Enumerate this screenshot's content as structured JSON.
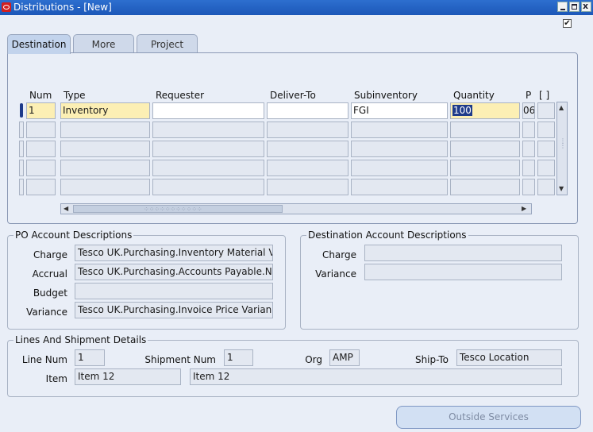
{
  "window": {
    "title": "Distributions - [New]"
  },
  "tabs": [
    "Destination",
    "More",
    "Project"
  ],
  "grid": {
    "headers": [
      "Num",
      "Type",
      "Requester",
      "Deliver-To",
      "Subinventory",
      "Quantity",
      "P",
      "[ ]"
    ],
    "row1": {
      "num": "1",
      "type": "Inventory",
      "requester": "",
      "deliver_to": "",
      "subinventory": "FGI",
      "quantity": "100",
      "p": "06"
    }
  },
  "po_account": {
    "title": "PO Account Descriptions",
    "labels": {
      "charge": "Charge",
      "accrual": "Accrual",
      "budget": "Budget",
      "variance": "Variance"
    },
    "values": {
      "charge": "Tesco UK.Purchasing.Inventory Material V",
      "accrual": "Tesco UK.Purchasing.Accounts Payable.N",
      "budget": "",
      "variance": "Tesco UK.Purchasing.Invoice Price Varian"
    }
  },
  "dest_account": {
    "title": "Destination Account Descriptions",
    "labels": {
      "charge": "Charge",
      "variance": "Variance"
    },
    "values": {
      "charge": "",
      "variance": ""
    }
  },
  "lines": {
    "title": "Lines And Shipment Details",
    "labels": {
      "line_num": "Line Num",
      "shipment_num": "Shipment Num",
      "org": "Org",
      "ship_to": "Ship-To",
      "item": "Item"
    },
    "values": {
      "line_num": "1",
      "shipment_num": "1",
      "org": "AMP",
      "ship_to": "Tesco Location",
      "item": "Item 12",
      "item_desc": "Item 12"
    }
  },
  "buttons": {
    "outside_services": "Outside Services"
  },
  "colors": {
    "titlebar": "#1c57b8",
    "required_field": "#fcefb4",
    "background": "#e9eef7"
  }
}
